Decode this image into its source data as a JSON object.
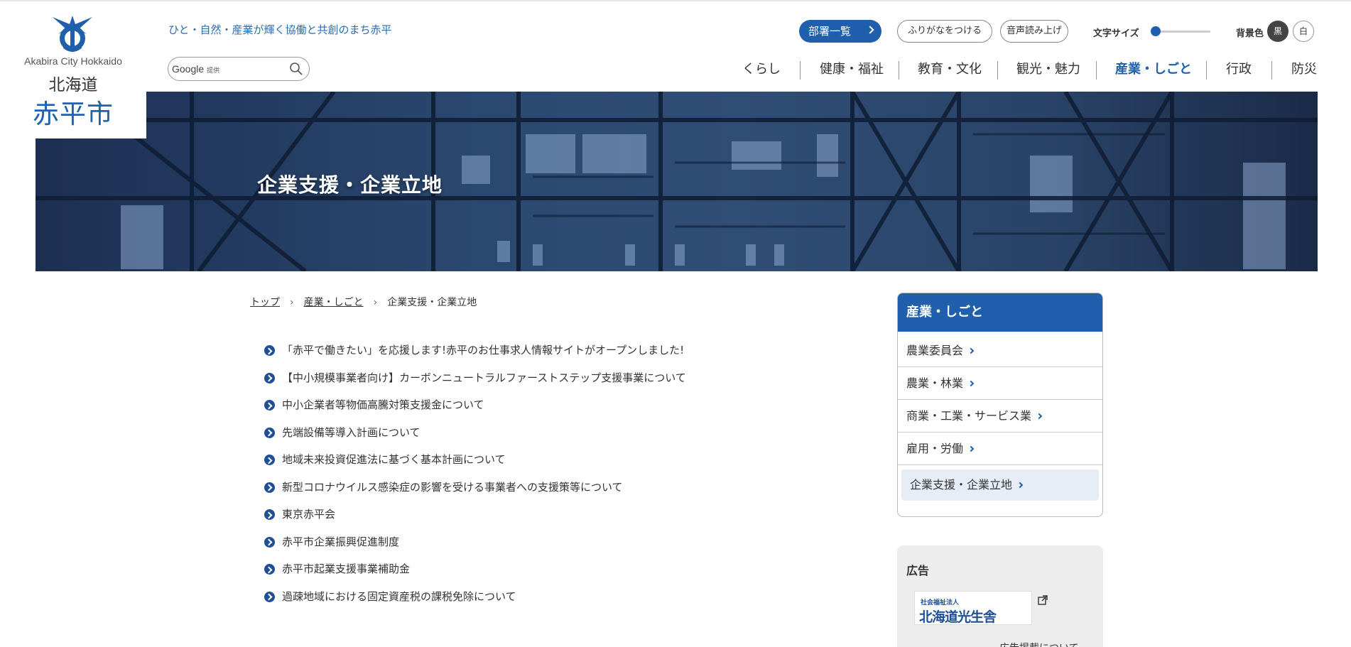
{
  "header": {
    "logo": {
      "english": "Akabira City Hokkaido",
      "prefecture": "北海道",
      "city": "赤平市"
    },
    "tagline": "ひと・自然・産業が輝く協働と共創のまち赤平",
    "search": {
      "brand": "Google",
      "provided": "提供"
    },
    "utility": {
      "departments_label": "部署一覧",
      "furigana_label": "ふりがなをつける",
      "read_aloud_label": "音声読み上げ",
      "font_size_label": "文字サイズ",
      "font_size_level": 0,
      "bg_color_label": "背景色",
      "bg_black_label": "黒",
      "bg_white_label": "白"
    },
    "nav": [
      {
        "label": "くらし"
      },
      {
        "label": "健康・福祉"
      },
      {
        "label": "教育・文化"
      },
      {
        "label": "観光・魅力"
      },
      {
        "label": "産業・しごと",
        "active": true
      },
      {
        "label": "行政"
      },
      {
        "label": "防災"
      }
    ],
    "accent_color": "#1f5fab"
  },
  "hero": {
    "title": "企業支援・企業立地"
  },
  "breadcrumb": [
    "トップ",
    "産業・しごと",
    "企業支援・企業立地"
  ],
  "content": {
    "links": [
      "「赤平で働きたい」を応援します!赤平のお仕事求人情報サイトがオープンしました!",
      "【中小規模事業者向け】カーボンニュートラルファーストステップ支援事業について",
      "中小企業者等物価高騰対策支援金について",
      "先端設備等導入計画について",
      "地域未来投資促進法に基づく基本計画について",
      "新型コロナウイルス感染症の影響を受ける事業者への支援策等について",
      "東京赤平会",
      "赤平市企業振興促進制度",
      "赤平市起業支援事業補助金",
      "過疎地域における固定資産税の課税免除について"
    ]
  },
  "sidebar": {
    "title": "産業・しごと",
    "items": [
      "農業委員会",
      "農業・林業",
      "商業・工業・サービス業",
      "雇用・労働",
      "企業支援・企業立地"
    ],
    "current_index": 4
  },
  "ad": {
    "title": "広告",
    "banner_small": "社会福祉法人",
    "banner_big": "北海道光生舎",
    "link_label": "広告掲載について"
  }
}
